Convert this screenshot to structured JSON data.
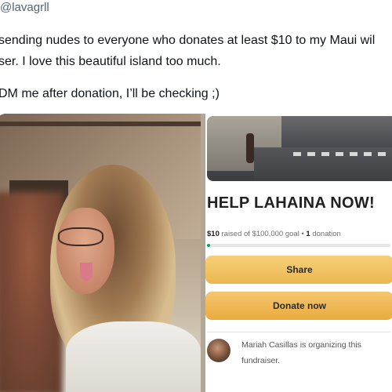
{
  "tweet": {
    "handle": "@lavagrll",
    "lines": [
      "sending nudes to everyone who donates at least $10 to my Maui wil",
      "ser. I love this beautiful island too much.",
      "DM me after donation, I’ll be checking ;)"
    ]
  },
  "fundraiser": {
    "title": "HELP LAHAINA NOW!",
    "raised_amount": "$10",
    "raised_text": " raised of $100,000 goal • ",
    "donations_count": "1",
    "donations_label": " donation",
    "progress_fraction": 0.0001,
    "share_label": "Share",
    "donate_label": "Donate now",
    "organizer_text": "Mariah Casillas is organizing this fundraiser.",
    "colors": {
      "share_button": "#ecb851",
      "donate_button": "#e9ab3f",
      "progress": "#02a95c"
    }
  }
}
